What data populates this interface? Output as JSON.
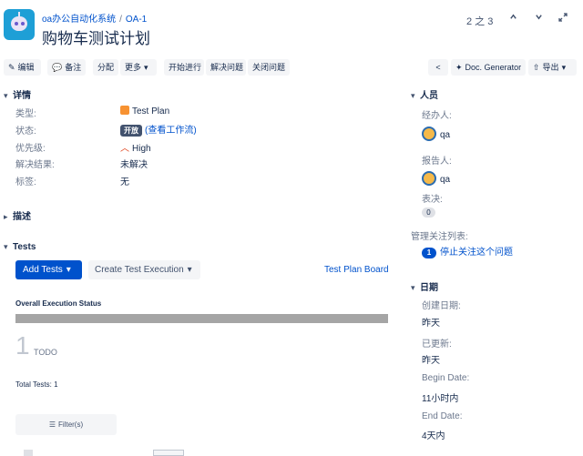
{
  "header": {
    "project_link": "oa办公自动化系统",
    "separator": "/",
    "issue_key": "OA-1",
    "title": "购物车测试计划",
    "pager": "2 之 3",
    "prev_icon": "chevron-up-icon",
    "next_icon": "chevron-down-icon",
    "expand_icon": "expand-icon"
  },
  "toolbar": {
    "edit": "编辑",
    "comment": "备注",
    "assign": "分配",
    "more": "更多",
    "start_progress": "开始进行",
    "resolve": "解决问题",
    "close": "关闭问题",
    "doc_generator": "Doc. Generator",
    "export": "导出"
  },
  "details": {
    "section_title": "详情",
    "type_label": "类型:",
    "type_value": "Test Plan",
    "status_label": "状态:",
    "status_value": "开放",
    "workflow_link": "(查看工作流)",
    "priority_label": "优先级:",
    "priority_value": "High",
    "resolution_label": "解决结果:",
    "resolution_value": "未解决",
    "labels_label": "标签:",
    "labels_value": "无"
  },
  "description": {
    "section_title": "描述"
  },
  "tests": {
    "section_title": "Tests",
    "add_tests": "Add Tests",
    "create_execution": "Create Test Execution",
    "plan_board": "Test Plan Board",
    "overall_status": "Overall Execution Status",
    "progress_fraction": 1.0,
    "todo_count": "1",
    "todo_label": "TODO",
    "total_tests": "Total Tests: 1",
    "filter": "Filter(s)"
  },
  "people": {
    "section_title": "人员",
    "assignee_label": "经办人:",
    "assignee_name": "qa",
    "reporter_label": "报告人:",
    "reporter_name": "qa",
    "votes_label": "表决:",
    "votes_count": "0",
    "watchers_label": "管理关注列表:",
    "watchers_count": "1",
    "unwatch_link": "停止关注这个问题"
  },
  "dates": {
    "section_title": "日期",
    "created_label": "创建日期:",
    "created_value": "昨天",
    "updated_label": "已更新:",
    "updated_value": "昨天",
    "begin_label": "Begin Date:",
    "begin_value": "11小时内",
    "end_label": "End Date:",
    "end_value": "4天内"
  },
  "colors": {
    "primary": "#0052cc",
    "status_lozenge": "#42526e",
    "project_avatar": "#1e9fd6",
    "priority_high": "#de350b",
    "progress_todo": "#a5a5a5"
  }
}
